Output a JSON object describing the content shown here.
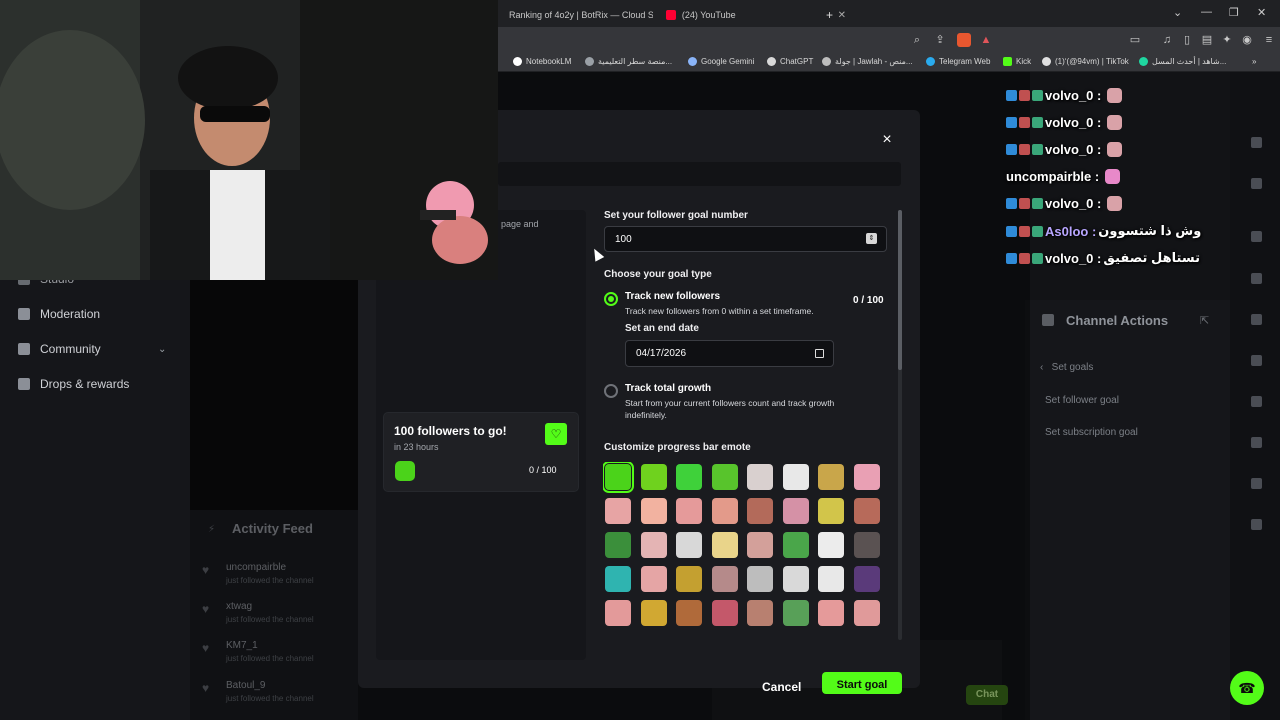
{
  "browser": {
    "tabs": [
      {
        "label": "Ranking of 4o2y | BotRix — Cloud St",
        "favicon_color": "#e8e8e8"
      },
      {
        "label": "(24) YouTube",
        "favicon_color": "#ff0033"
      }
    ],
    "new_tab": "+",
    "window_controls": [
      "⌄",
      "—",
      "❐",
      "✕"
    ],
    "bookmarks": [
      {
        "label": "NotebookLM",
        "color": "#ffffff"
      },
      {
        "label": "منصة سطر التعليمية...",
        "color": "#9aa0a6"
      },
      {
        "label": "Google Gemini",
        "color": "#8ab4f8"
      },
      {
        "label": "ChatGPT",
        "color": "#d9d9d9"
      },
      {
        "label": "جولة | Jawlah - منص...",
        "color": "#bdbdbd"
      },
      {
        "label": "Telegram Web",
        "color": "#2aabee"
      },
      {
        "label": "Kick",
        "color": "#53fc18"
      },
      {
        "label": "(1)‘(@94vm) | TikTok",
        "color": "#e0e0e0"
      },
      {
        "label": "شاهد | أحدث المسل...",
        "color": "#1fd6a0"
      }
    ],
    "bookmarks_more": "»"
  },
  "sidenav": {
    "items": [
      {
        "label": "Studio",
        "icon": "studio-icon"
      },
      {
        "label": "Moderation",
        "icon": "sword-icon"
      },
      {
        "label": "Community",
        "icon": "people-icon"
      },
      {
        "label": "Drops & rewards",
        "icon": "gift-icon"
      }
    ],
    "chevron": "⌄"
  },
  "activity_feed": {
    "title": "Activity Feed",
    "items": [
      {
        "name": "uncompairble",
        "action": "just followed the channel"
      },
      {
        "name": "xtwag",
        "action": "just followed the channel"
      },
      {
        "name": "KM7_1",
        "action": "just followed the channel"
      },
      {
        "name": "Batoul_9",
        "action": "just followed the channel"
      }
    ]
  },
  "channel_actions": {
    "title": "Channel Actions",
    "back_label": "Set goals",
    "links": [
      "Set follower goal",
      "Set subscription goal"
    ]
  },
  "chat_overlay": [
    {
      "user": "volvo_0",
      "sep": ":",
      "user_color": "#ffffff"
    },
    {
      "user": "volvo_0",
      "sep": ":",
      "user_color": "#ffffff"
    },
    {
      "user": "volvo_0",
      "sep": ":",
      "user_color": "#ffffff"
    },
    {
      "user": "uncompairble",
      "sep": ":",
      "user_color": "#ffffff"
    },
    {
      "user": "volvo_0",
      "sep": ":",
      "user_color": "#ffffff"
    },
    {
      "user": "As0loo",
      "sep": ":",
      "message": "وش ذا شتسوون",
      "user_color": "#b8a6ff"
    },
    {
      "user": "volvo_0",
      "sep": ":",
      "message": "تستاهل تصفيق",
      "user_color": "#ffffff"
    }
  ],
  "chat_input": {
    "send_label": "Chat"
  },
  "modal": {
    "close": "×",
    "left_snippet": "page and",
    "preview": {
      "title": "100 followers to go!",
      "subtitle": "in 23 hours",
      "count": "0 / 100"
    },
    "goal_number_label": "Set your follower goal number",
    "goal_number_value": "100",
    "goal_type_label": "Choose your goal type",
    "option_new": {
      "title": "Track new followers",
      "desc": "Track new followers from 0 within a set timeframe.",
      "count": "0 / 100",
      "selected": true
    },
    "end_date_label": "Set an end date",
    "end_date_value": "04/17/2026",
    "option_total": {
      "title": "Track total growth",
      "desc": "Start from your current followers count and track growth indefinitely.",
      "selected": false
    },
    "emote_label": "Customize progress bar emote",
    "emotes": [
      "#4bd31a",
      "#6fd21e",
      "#3fd13a",
      "#58c42c",
      "#d9d0cf",
      "#e8e8e8",
      "#c9a64a",
      "#e9a0b4",
      "#e7a4a4",
      "#f2b2a0",
      "#e59a9a",
      "#e39a8a",
      "#b36a5a",
      "#d591a6",
      "#d2c54a",
      "#b76a5a",
      "#3b8f3b",
      "#e4b4b4",
      "#d8d8d8",
      "#e9d48a",
      "#d3a09a",
      "#4aa64a",
      "#ececec",
      "#5a5252",
      "#2fb4b0",
      "#e5a5a5",
      "#c4a030",
      "#b58a8a",
      "#bdbdbd",
      "#d9d9d9",
      "#e8e8e8",
      "#5a3a7a",
      "#e39a9a",
      "#d1a832",
      "#b06a3a",
      "#c4586a",
      "#b88070",
      "#58a058",
      "#e59a9a",
      "#e09a9a"
    ],
    "cancel_label": "Cancel",
    "start_label": "Start goal"
  }
}
